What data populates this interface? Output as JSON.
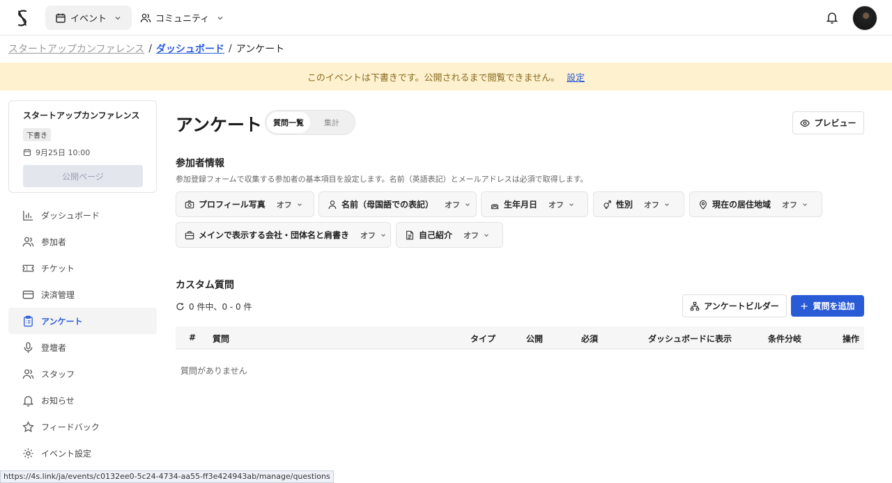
{
  "topbar": {
    "logo_icon": "logo-icon",
    "nav_event": "イベント",
    "nav_community": "コミュニティ",
    "bell_icon": "bell-icon"
  },
  "breadcrumb": {
    "item1": "スタートアップカンファレンス",
    "sep": "/",
    "item2": "ダッシュボード",
    "item3": "アンケート"
  },
  "banner": {
    "text": "このイベントは下書きです。公開されるまで閲覧できません。",
    "link": "設定"
  },
  "event_card": {
    "name": "スタートアップカンファレンス",
    "status": "下書き",
    "date": "9月25日 10:00",
    "public_button": "公開ページ"
  },
  "sidebar": {
    "items": [
      {
        "label": "ダッシュボード",
        "icon": "bar-chart-icon"
      },
      {
        "label": "参加者",
        "icon": "users-icon"
      },
      {
        "label": "チケット",
        "icon": "ticket-icon"
      },
      {
        "label": "決済管理",
        "icon": "credit-card-icon"
      },
      {
        "label": "アンケート",
        "icon": "clipboard-icon",
        "active": true
      },
      {
        "label": "登壇者",
        "icon": "mic-icon"
      },
      {
        "label": "スタッフ",
        "icon": "staff-icon"
      },
      {
        "label": "お知らせ",
        "icon": "bell-icon"
      },
      {
        "label": "フィードバック",
        "icon": "star-icon"
      },
      {
        "label": "イベント設定",
        "icon": "gear-icon"
      }
    ]
  },
  "main": {
    "title": "アンケート",
    "tabs": [
      "質問一覧",
      "集計"
    ],
    "active_tab": "質問一覧",
    "preview_button": "プレビュー"
  },
  "participant_info": {
    "title": "参加者情報",
    "description": "参加登録フォームで収集する参加者の基本項目を設定します。名前（英語表記）とメールアドレスは必須で取得します。",
    "chips": [
      {
        "label": "プロフィール写真",
        "state": "オフ",
        "icon": "camera-icon"
      },
      {
        "label": "名前（母国語での表記）",
        "state": "オフ",
        "icon": "person-icon"
      },
      {
        "label": "生年月日",
        "state": "オフ",
        "icon": "cake-icon"
      },
      {
        "label": "性別",
        "state": "オフ",
        "icon": "gender-icon"
      },
      {
        "label": "現在の居住地域",
        "state": "オフ",
        "icon": "map-pin-icon"
      },
      {
        "label": "メインで表示する会社・団体名と肩書き",
        "state": "オフ",
        "icon": "briefcase-icon"
      },
      {
        "label": "自己紹介",
        "state": "オフ",
        "icon": "document-icon"
      }
    ]
  },
  "custom_questions": {
    "title": "カスタム質問",
    "count_text": "0 件中、0 - 0 件",
    "builder_button": "アンケートビルダー",
    "add_button": "質問を追加",
    "columns": [
      "#",
      "質問",
      "タイプ",
      "公開",
      "必須",
      "ダッシュボードに表示",
      "条件分岐",
      "操作"
    ],
    "empty_text": "質問がありません"
  },
  "statusbar": {
    "url": "https://4s.link/ja/events/c0132ee0-5c24-4734-aa55-ff3e424943ab/manage/questions"
  },
  "colors": {
    "accent": "#2a5bd7",
    "banner_bg": "#fdf1cf",
    "banner_text": "#8a6a1f"
  }
}
